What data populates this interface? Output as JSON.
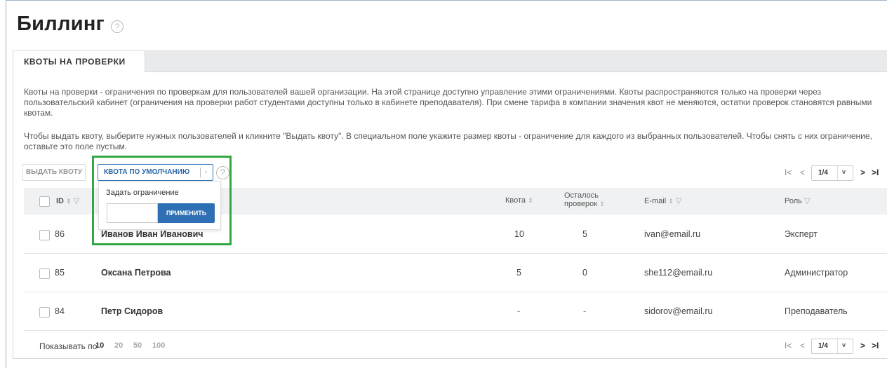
{
  "page": {
    "title": "Биллинг",
    "help_glyph": "?"
  },
  "tabs": [
    {
      "label": "КВОТЫ НА ПРОВЕРКИ",
      "active": true
    }
  ],
  "description": {
    "p1": "Квоты на проверки - ограничения по проверкам для пользователей вашей организации. На этой странице доступно управление этими ограничениями. Квоты распространяются только на проверки через пользовательский кабинет (ограничения на проверки работ студентами доступны только в кабинете преподавателя). При смене тарифа в компании значения квот не меняются, остатки проверок становятся равными квотам.",
    "p2": "Чтобы выдать квоту, выберите нужных пользователей и кликните \"Выдать квоту\". В специальном поле укажите размер квоты - ограничение для каждого из выбранных пользователей. Чтобы снять с них ограничение, оставьте это поле пустым."
  },
  "toolbar": {
    "issue_label": "ВЫДАТЬ КВОТУ",
    "default_label": "КВОТА ПО УМОЛЧАНИЮ",
    "default_arrow": "-",
    "help_glyph": "?"
  },
  "dropdown": {
    "label": "Задать ограничение",
    "input_value": "",
    "apply_label": "ПРИМЕНИТЬ"
  },
  "pager": {
    "first": "I<",
    "prev": "<",
    "current": "1/4",
    "caret": "v",
    "next": ">",
    "last": ">I"
  },
  "table": {
    "columns": {
      "id": "ID",
      "quota": "Квота",
      "remaining_1": "Осталось",
      "remaining_2": "проверок",
      "email": "E-mail",
      "role": "Роль"
    },
    "sort_glyph": "⇕",
    "filter_glyph": "▽",
    "rows": [
      {
        "id": "86",
        "name": "Иванов Иван Иванович",
        "quota": "10",
        "remaining": "5",
        "email": "ivan@email.ru",
        "role": "Эксперт"
      },
      {
        "id": "85",
        "name": "Оксана Петрова",
        "quota": "5",
        "remaining": "0",
        "email": "she112@email.ru",
        "role": "Администратор"
      },
      {
        "id": "84",
        "name": "Петр Сидоров",
        "quota": "-",
        "remaining": "-",
        "email": "sidorov@email.ru",
        "role": "Преподаватель"
      }
    ]
  },
  "footer": {
    "show_label": "Показывать по",
    "page_sizes": [
      "10",
      "20",
      "50",
      "100"
    ],
    "active_size": "10"
  },
  "colors": {
    "accent": "#2f6fb3",
    "highlight": "#31a845"
  }
}
